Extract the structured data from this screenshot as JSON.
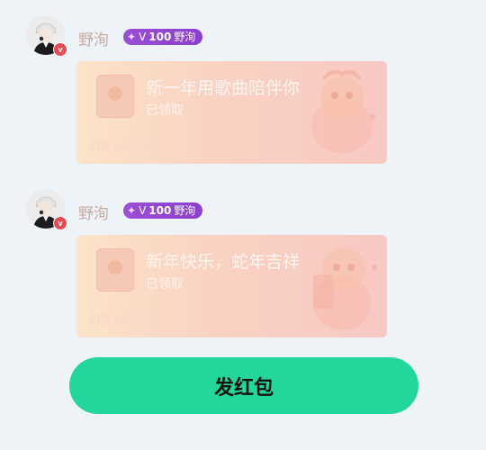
{
  "messages": [
    {
      "username": "野洵",
      "level_badge": {
        "icon": "sparkle-icon",
        "prefix": "V",
        "level": "100",
        "name": "野洵"
      },
      "avatar_badge": "v",
      "card": {
        "title": "新一年用歌曲陪伴你",
        "status": "已领取",
        "footer": "明星勋章红包"
      }
    },
    {
      "username": "野洵",
      "level_badge": {
        "icon": "sparkle-icon",
        "prefix": "V",
        "level": "100",
        "name": "野洵"
      },
      "avatar_badge": "v",
      "card": {
        "title": "新年快乐，蛇年吉祥",
        "status": "已领取",
        "footer": "明星勋章红包"
      }
    }
  ],
  "send_button": {
    "label": "发红包"
  },
  "colors": {
    "background": "#eef3f7",
    "send_button": "#23d69b",
    "level_badge": "#9b4fd6",
    "avatar_badge": "#e54b55"
  }
}
